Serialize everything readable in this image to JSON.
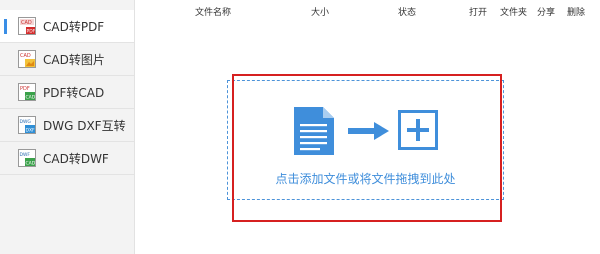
{
  "sidebar": {
    "items": [
      {
        "label": "CAD转PDF",
        "icon": "cad-to-pdf-icon",
        "active": true
      },
      {
        "label": "CAD转图片",
        "icon": "cad-to-image-icon",
        "active": false
      },
      {
        "label": "PDF转CAD",
        "icon": "pdf-to-cad-icon",
        "active": false
      },
      {
        "label": "DWG DXF互转",
        "icon": "dwg-dxf-convert-icon",
        "active": false
      },
      {
        "label": "CAD转DWF",
        "icon": "cad-to-dwf-icon",
        "active": false
      }
    ]
  },
  "header": {
    "columns": [
      "文件名称",
      "大小",
      "状态",
      "打开",
      "文件夹",
      "分享",
      "删除"
    ]
  },
  "dropzone": {
    "text": "点击添加文件或将文件拖拽到此处"
  },
  "colors": {
    "accent": "#3f8edb",
    "highlight": "#d62020",
    "active_marker": "#3a8ee6"
  }
}
